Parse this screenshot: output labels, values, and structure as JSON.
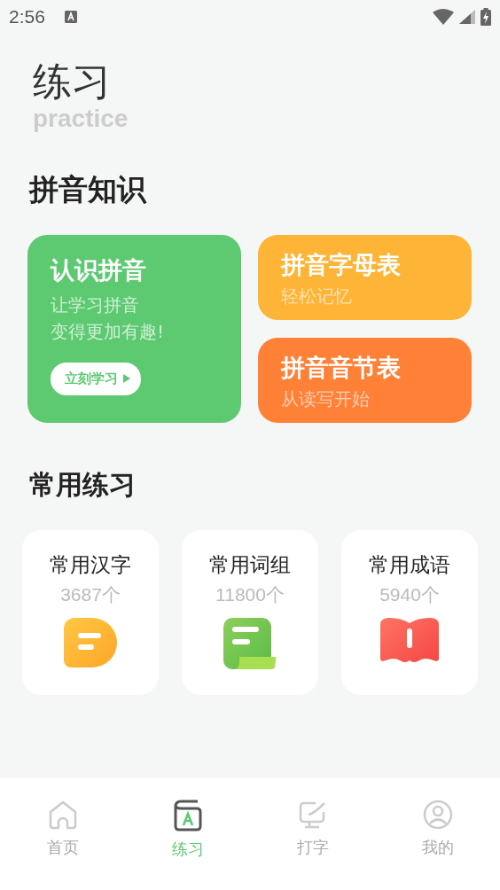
{
  "status_bar": {
    "time": "2:56"
  },
  "header": {
    "title": "练习",
    "subtitle": "practice"
  },
  "pinyin_section": {
    "title": "拼音知识",
    "main_card": {
      "title": "认识拼音",
      "lines": [
        "让学习拼音",
        "变得更加有趣!"
      ],
      "button": "立刻学习",
      "color": "#5dc971"
    },
    "side_cards": [
      {
        "title": "拼音字母表",
        "subtitle": "轻松记忆",
        "color": "#feb436"
      },
      {
        "title": "拼音音节表",
        "subtitle": "从读写开始",
        "color": "#fe8137"
      }
    ]
  },
  "practice_section": {
    "title": "常用练习",
    "items": [
      {
        "title": "常用汉字",
        "count": "3687个",
        "kind": "bubble"
      },
      {
        "title": "常用词组",
        "count": "11800个",
        "kind": "scroll"
      },
      {
        "title": "常用成语",
        "count": "5940个",
        "kind": "book"
      }
    ]
  },
  "tabs": [
    {
      "label": "首页",
      "kind": "home",
      "selected": false
    },
    {
      "label": "练习",
      "kind": "practice",
      "selected": true
    },
    {
      "label": "打字",
      "kind": "typing",
      "selected": false
    },
    {
      "label": "我的",
      "kind": "profile",
      "selected": false
    }
  ]
}
